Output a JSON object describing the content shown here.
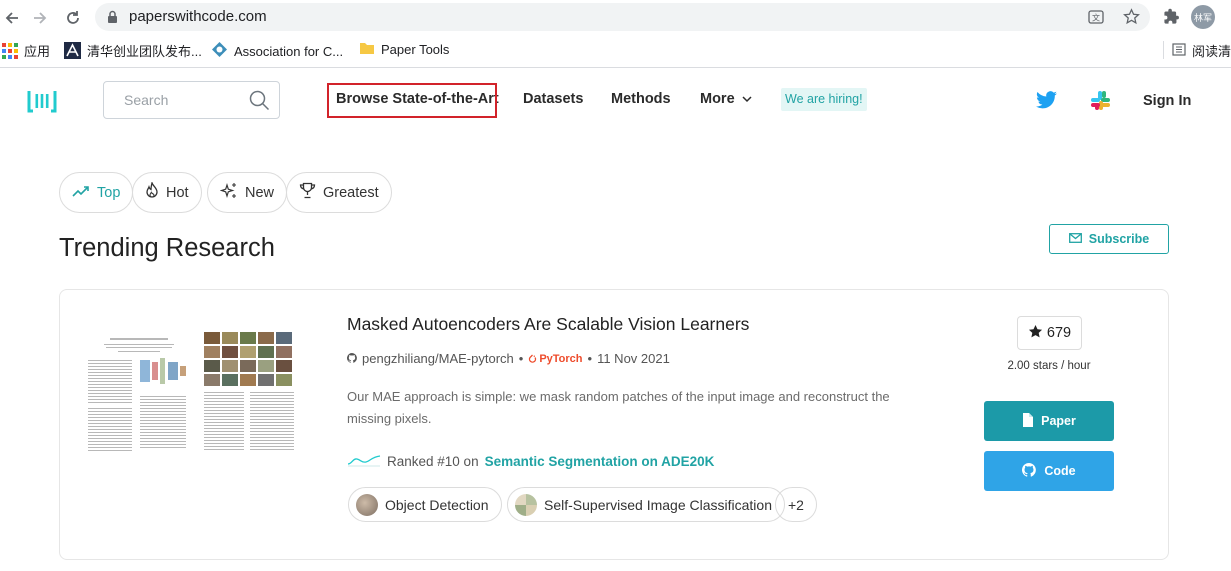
{
  "browser": {
    "url": "paperswithcode.com",
    "profile_initials": "林军",
    "bookmarks": [
      {
        "label": "应用",
        "icon": "apps-grid-icon"
      },
      {
        "label": "清华创业团队发布...",
        "icon": "site-favicon"
      },
      {
        "label": "Association for C...",
        "icon": "acm-diamond-icon"
      },
      {
        "label": "Paper Tools",
        "icon": "folder-icon"
      }
    ],
    "reading_list": "阅读清"
  },
  "site": {
    "search_placeholder": "Search",
    "nav": {
      "browse": "Browse State-of-the-Art",
      "datasets": "Datasets",
      "methods": "Methods",
      "more": "More",
      "hiring": "We are hiring!"
    },
    "sign_in": "Sign In"
  },
  "filters": [
    {
      "label": "Top",
      "icon": "trend-up-icon",
      "active": true
    },
    {
      "label": "Hot",
      "icon": "flame-icon",
      "active": false
    },
    {
      "label": "New",
      "icon": "sparkle-icon",
      "active": false
    },
    {
      "label": "Greatest",
      "icon": "trophy-icon",
      "active": false
    }
  ],
  "section": {
    "title": "Trending Research",
    "subscribe": "Subscribe"
  },
  "paper": {
    "title": "Masked Autoencoders Are Scalable Vision Learners",
    "repo": "pengzhiliang/MAE-pytorch",
    "framework": "PyTorch",
    "date": "11 Nov 2021",
    "abstract": "Our MAE approach is simple: we mask random patches of the input image and reconstruct the missing pixels.",
    "ranked_prefix": "Ranked #10 on",
    "ranked_task": "Semantic Segmentation on ADE20K",
    "tags": [
      "Object Detection",
      "Self-Supervised Image Classification"
    ],
    "more_tags": "+2",
    "stars": "679",
    "stars_rate": "2.00 stars / hour",
    "paper_button": "Paper",
    "code_button": "Code"
  },
  "colors": {
    "accent": "#21a3a4",
    "paper_button": "#1c9aa8",
    "code_button": "#2fa4e7",
    "highlight_box": "#d2232a"
  }
}
